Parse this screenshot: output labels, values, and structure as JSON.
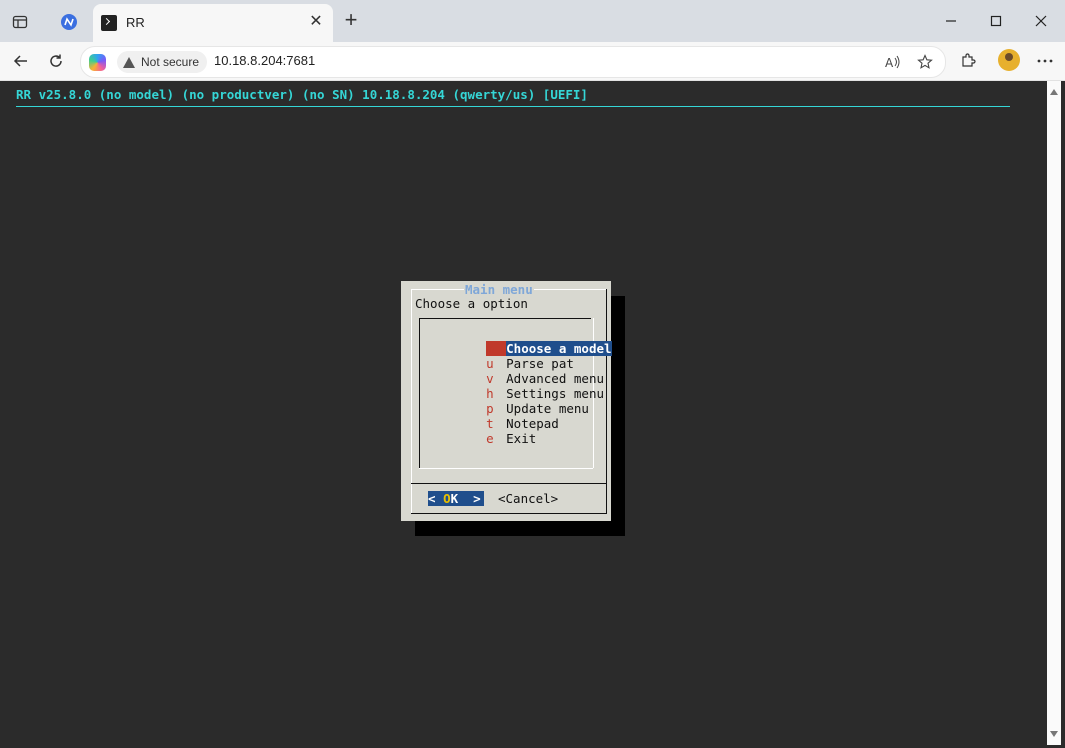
{
  "browser": {
    "tab_title": "RR",
    "url": "10.18.8.204:7681",
    "security_label": "Not secure",
    "close_symbol": "✕",
    "new_tab_symbol": "+"
  },
  "terminal": {
    "header": "RR v25.8.0 (no model) (no productver) (no SN) 10.18.8.204 (qwerty/us) [UEFI]",
    "dialog": {
      "title": "Main menu",
      "prompt": "Choose a option",
      "items": [
        {
          "key": "m",
          "label": "Choose a model"
        },
        {
          "key": "u",
          "label": "Parse pat"
        },
        {
          "key": "v",
          "label": "Advanced menu"
        },
        {
          "key": "h",
          "label": "Settings menu"
        },
        {
          "key": "p",
          "label": "Update menu"
        },
        {
          "key": "t",
          "label": "Notepad"
        },
        {
          "key": "e",
          "label": "Exit"
        }
      ],
      "ok_left": "< ",
      "ok_hot": "O",
      "ok_rest": "K  >",
      "cancel_label": "<Cancel>"
    }
  },
  "colors": {
    "terminal_bg": "#2b2b2b",
    "header_text": "#35d6d6",
    "dialog_bg": "#d8d8d0",
    "selection_bg": "#1f4e8c",
    "hotkey": "#c0392b"
  }
}
